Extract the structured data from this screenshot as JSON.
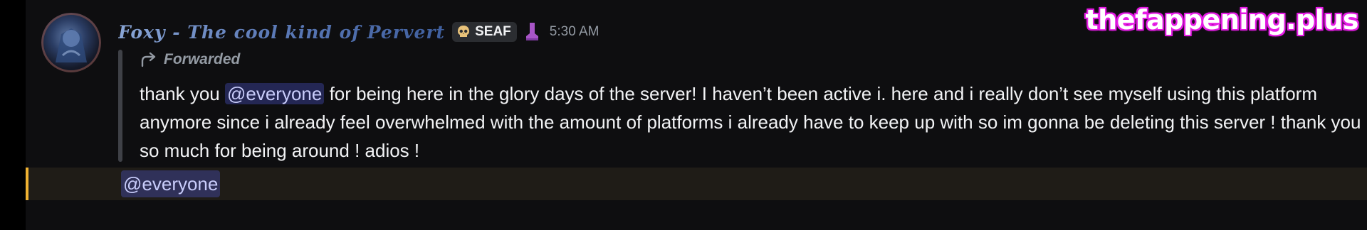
{
  "message": {
    "username": "Foxy - The cool kind of Pervert",
    "tag_label": "SEAF",
    "tag_icon": "skull-icon",
    "role_icon": "boot-icon",
    "timestamp": "5:30 AM",
    "forward_label": "Forwarded",
    "content_before_mention": "thank you ",
    "mention": "@everyone",
    "content_after_mention": " for being here in the glory days of the server! I haven’t been active i. here and i really don’t see myself using this platform anymore since i already feel overwhelmed with the amount of platforms i already have to keep up with so im gonna be deleting this server ! thank you so much for being around ! adios !",
    "highlight_mention": "@everyone"
  },
  "watermark": "thefappening.plus",
  "colors": {
    "background": "#0e0e10",
    "mention_bg": "#5865f2",
    "highlight_border": "#f0b232",
    "watermark_glow": "#e61ee6"
  }
}
